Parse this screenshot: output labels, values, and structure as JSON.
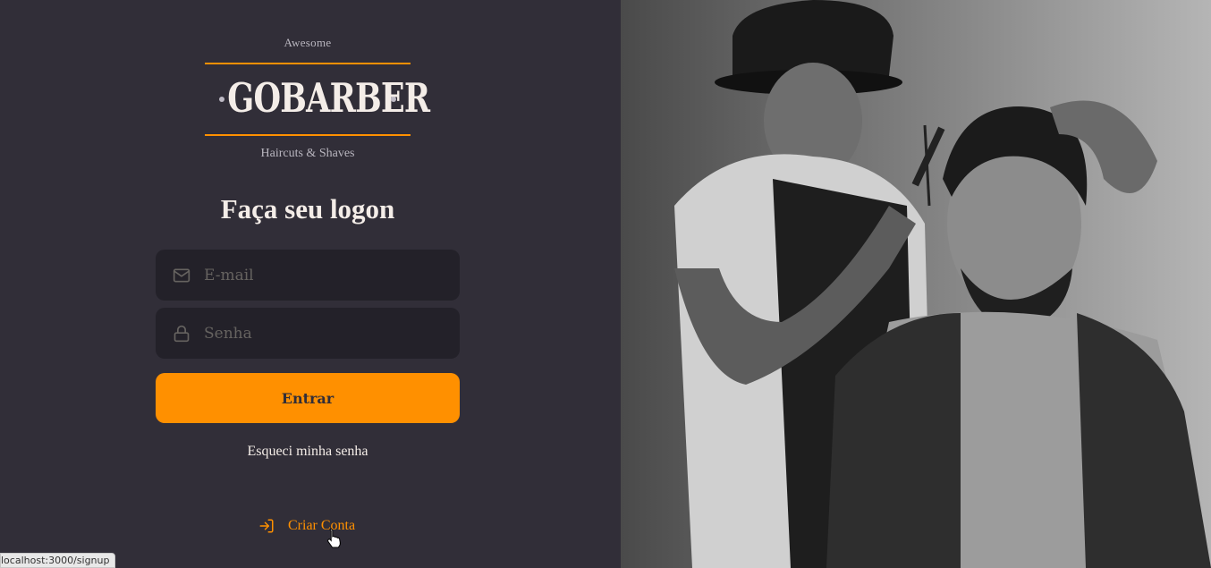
{
  "logo": {
    "top_text": "Awesome",
    "wordmark": "GOBARBER",
    "bottom_text": "Haircuts & Shaves",
    "accent_color": "#ff9000"
  },
  "form": {
    "title": "Faça seu logon",
    "email": {
      "placeholder": "E-mail",
      "value": "",
      "icon": "mail-icon"
    },
    "password": {
      "placeholder": "Senha",
      "value": "",
      "icon": "lock-icon"
    },
    "submit_label": "Entrar",
    "forgot_label": "Esqueci minha senha"
  },
  "signup": {
    "label": "Criar Conta",
    "icon": "log-in-icon"
  },
  "hero_image": {
    "description_icon": "barber-photo"
  },
  "status_bar": {
    "url": "localhost:3000/signup"
  },
  "colors": {
    "background": "#312e38",
    "input_bg": "#232129",
    "accent": "#ff9000",
    "text": "#f4ede8",
    "placeholder": "#666360"
  }
}
